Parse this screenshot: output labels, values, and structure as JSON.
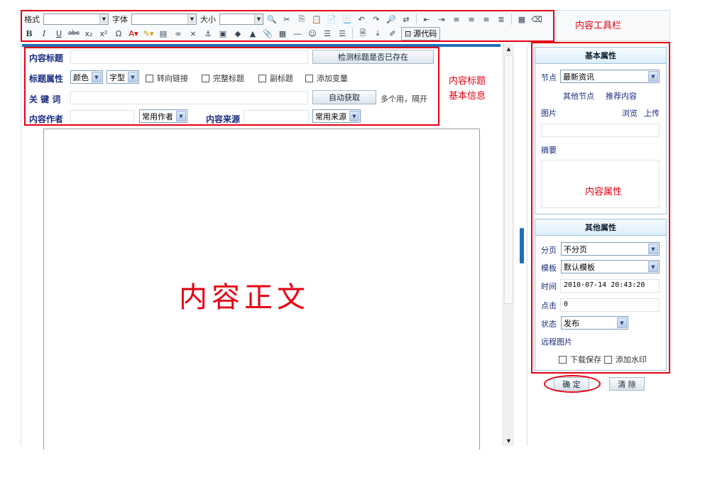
{
  "toolbar": {
    "format_label": "格式",
    "font_label": "字体",
    "size_label": "大小",
    "source_label": "源代码",
    "annotation": "内容工具栏",
    "row2_buttons": [
      "B",
      "I",
      "U",
      "abc",
      "x₂",
      "x²",
      "Ω"
    ]
  },
  "form": {
    "title_label": "内容标题",
    "check_title_button": "检测标题是否已存在",
    "title_attr_label": "标题属性",
    "color_select": "颜色",
    "font_select": "字型",
    "checks": [
      "转向链接",
      "完整标题",
      "副标题",
      "添加变量"
    ],
    "keywords_label": "关 键 词",
    "auto_fetch_button": "自动获取",
    "keywords_hint": "多个用，隔开",
    "author_label": "内容作者",
    "author_select": "常用作者",
    "source_label": "内容来源",
    "source_select": "常用来源",
    "annotation_line1": "内容标题",
    "annotation_line2": "基本信息"
  },
  "editor": {
    "body_annotation": "内容正文"
  },
  "basic_panel": {
    "title": "基本属性",
    "node_label": "节点",
    "node_value": "最新资讯",
    "other_nodes_link": "其他节点",
    "recommend_link": "推荐内容",
    "image_label": "图片",
    "browse_link": "浏览",
    "upload_link": "上传",
    "summary_label": "摘要",
    "annotation": "内容属性"
  },
  "other_panel": {
    "title": "其他属性",
    "paging_label": "分页",
    "paging_value": "不分页",
    "template_label": "模板",
    "template_value": "默认模板",
    "time_label": "时间",
    "time_value": "2010-07-14 20:43:20",
    "clicks_label": "点击",
    "clicks_value": "0",
    "status_label": "状态",
    "status_value": "发布",
    "remote_image_label": "远程图片",
    "download_save": "下载保存",
    "add_watermark": "添加水印"
  },
  "actions": {
    "confirm": "确 定",
    "clear": "清 除"
  },
  "colors": {
    "annotation_red": "#e60012",
    "label_blue": "#1a2c80",
    "panel_border": "#9ec5e0",
    "accent_bar": "#1f6fb5"
  }
}
